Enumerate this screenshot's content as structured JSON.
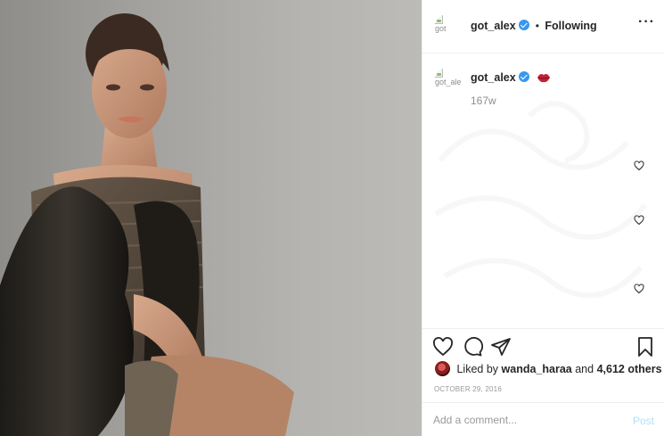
{
  "post": {
    "photo_icon": "portrait-photo"
  },
  "header": {
    "username": "got_alex",
    "avatar_alt": "got",
    "verified": true,
    "separator": "•",
    "follow_status": "Following",
    "more_icon": "more-horizontal-icon"
  },
  "caption": {
    "username": "got_alex",
    "avatar_alt": "got_alex's",
    "emoji": "kiss-lips-emoji",
    "time_ago": "167w"
  },
  "actions": {
    "like_icon": "heart-icon",
    "comment_icon": "comment-icon",
    "share_icon": "paper-plane-icon",
    "save_icon": "bookmark-icon"
  },
  "likes": {
    "prefix": "Liked by",
    "first_user": "wanda_haraa",
    "joiner": "and",
    "others": "4,612 others"
  },
  "date": "OCTOBER 29, 2016",
  "comment": {
    "placeholder": "Add a comment...",
    "post_label": "Post"
  },
  "colors": {
    "verified_blue": "#3897f0",
    "post_disabled": "#b2dffc",
    "border": "#efefef",
    "secondary_text": "#8e8e8e"
  }
}
